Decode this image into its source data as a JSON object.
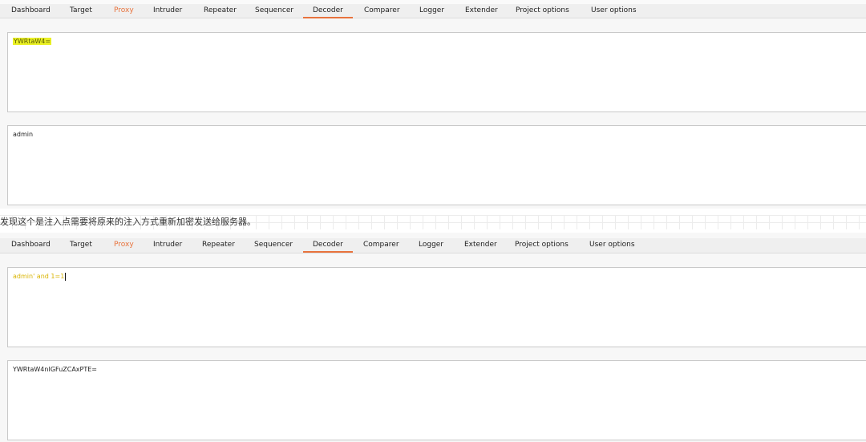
{
  "tabs": [
    "Dashboard",
    "Target",
    "Proxy",
    "Intruder",
    "Repeater",
    "Sequencer",
    "Decoder",
    "Comparer",
    "Logger",
    "Extender",
    "Project options",
    "User options"
  ],
  "active_tab": "Decoder",
  "accent_color": "#e8733d",
  "shot1": {
    "input_text": "YWRtaW4=",
    "output_text": "admin"
  },
  "caption": "发现这个是注入点需要将原来的注入方式重新加密发送给服务器。",
  "shot2": {
    "input_text": "admin' and 1=1",
    "output_text": "YWRtaW4nIGFuZCAxPTE="
  }
}
